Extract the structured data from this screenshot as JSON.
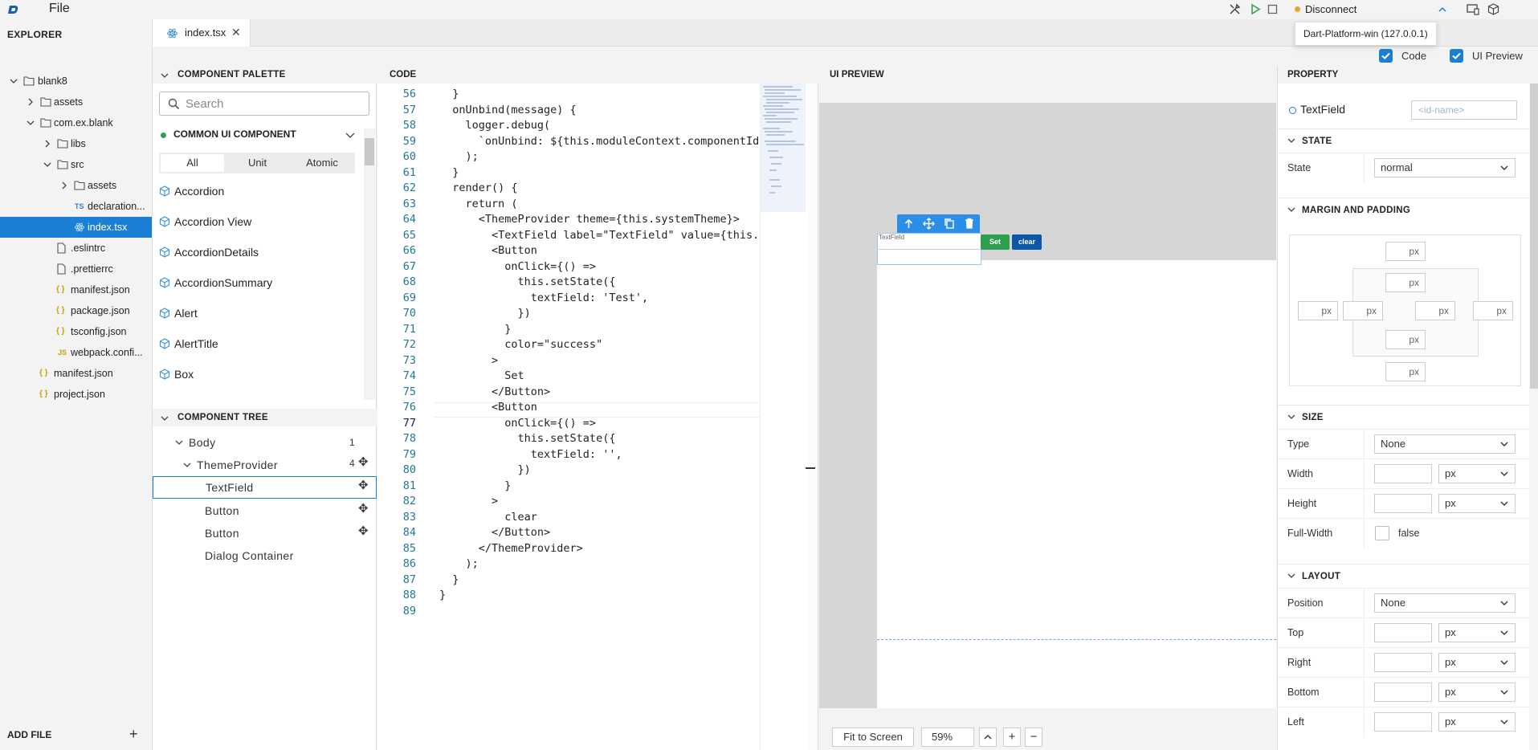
{
  "topbar": {
    "menu_file": "File",
    "connection_label": "Disconnect",
    "connection_status_color": "#f0a030",
    "tooltip": "Dart-Platform-win (127.0.0.1)",
    "icons": [
      "app-logo-icon",
      "tools-icon",
      "play-icon",
      "stop-icon",
      "chevron-up-icon",
      "screen-icon",
      "package-icon"
    ]
  },
  "explorer": {
    "title": "EXPLORER",
    "items": [
      {
        "label": "blank8",
        "type": "folder",
        "expanded": true
      },
      {
        "label": "assets",
        "type": "folder",
        "expanded": false
      },
      {
        "label": "com.ex.blank",
        "type": "folder",
        "expanded": true
      },
      {
        "label": "libs",
        "type": "folder",
        "expanded": false
      },
      {
        "label": "src",
        "type": "folder",
        "expanded": true
      },
      {
        "label": "assets",
        "type": "folder",
        "expanded": false
      },
      {
        "label": "declaration...",
        "type": "ts",
        "badge": "TS"
      },
      {
        "label": "index.tsx",
        "type": "tsx",
        "active": true
      },
      {
        "label": ".eslintrc",
        "type": "file"
      },
      {
        "label": ".prettierrc",
        "type": "file"
      },
      {
        "label": "manifest.json",
        "type": "json",
        "badge": "{ }"
      },
      {
        "label": "package.json",
        "type": "json",
        "badge": "{ }"
      },
      {
        "label": "tsconfig.json",
        "type": "json",
        "badge": "{ }"
      },
      {
        "label": "webpack.confi...",
        "type": "js",
        "badge": "JS"
      },
      {
        "label": "manifest.json",
        "type": "json",
        "badge": "{ }"
      },
      {
        "label": "project.json",
        "type": "json",
        "badge": "{ }"
      }
    ],
    "add_file": "ADD FILE",
    "add_file_symbol": "+"
  },
  "tabs": [
    {
      "label": "index.tsx",
      "close": "✕"
    }
  ],
  "palette": {
    "title": "COMPONENT PALETTE",
    "search_placeholder": "Search",
    "group_title": "COMMON UI COMPONENT",
    "filters": [
      "All",
      "Unit",
      "Atomic"
    ],
    "selected_filter": "All",
    "items": [
      "Accordion",
      "Accordion View",
      "AccordionDetails",
      "AccordionSummary",
      "Alert",
      "AlertTitle",
      "Box"
    ]
  },
  "component_tree": {
    "title": "COMPONENT TREE",
    "nodes": [
      {
        "label": "Body",
        "count": "1"
      },
      {
        "label": "ThemeProvider",
        "count": "4"
      },
      {
        "label": "TextField",
        "selected": true
      },
      {
        "label": "Button"
      },
      {
        "label": "Button"
      },
      {
        "label": "Dialog Container"
      }
    ],
    "move_symbol": "✥"
  },
  "code": {
    "title": "CODE",
    "current_line": "77",
    "lines": [
      {
        "n": "56",
        "t": "  }"
      },
      {
        "n": "57",
        "t": "  onUnbind(message) {"
      },
      {
        "n": "58",
        "t": "    logger.debug("
      },
      {
        "n": "59",
        "t": "      `onUnbind: ${this.moduleContext.componentId}, ${JSON.st"
      },
      {
        "n": "60",
        "t": "    );"
      },
      {
        "n": "61",
        "t": "  }"
      },
      {
        "n": "62",
        "t": "  render() {"
      },
      {
        "n": "63",
        "t": "    return ("
      },
      {
        "n": "64",
        "t": "      <ThemeProvider theme={this.systemTheme}>"
      },
      {
        "n": "65",
        "t": "        <TextField label=\"TextField\" value={this.state.textField}></"
      },
      {
        "n": "66",
        "t": "        <Button"
      },
      {
        "n": "67",
        "t": "          onClick={() =>"
      },
      {
        "n": "68",
        "t": "            this.setState({"
      },
      {
        "n": "69",
        "t": "              textField: 'Test',"
      },
      {
        "n": "70",
        "t": "            })"
      },
      {
        "n": "71",
        "t": "          }"
      },
      {
        "n": "72",
        "t": "          color=\"success\""
      },
      {
        "n": "73",
        "t": "        >"
      },
      {
        "n": "74",
        "t": "          Set"
      },
      {
        "n": "75",
        "t": "        </Button>"
      },
      {
        "n": "76",
        "t": "        <Button"
      },
      {
        "n": "77",
        "t": "          onClick={() =>"
      },
      {
        "n": "78",
        "t": "            this.setState({"
      },
      {
        "n": "79",
        "t": "              textField: '',"
      },
      {
        "n": "80",
        "t": "            })"
      },
      {
        "n": "81",
        "t": "          }"
      },
      {
        "n": "82",
        "t": "        >"
      },
      {
        "n": "83",
        "t": "          clear"
      },
      {
        "n": "84",
        "t": "        </Button>"
      },
      {
        "n": "85",
        "t": "      </ThemeProvider>"
      },
      {
        "n": "86",
        "t": "    );"
      },
      {
        "n": "87",
        "t": "  }"
      },
      {
        "n": "88",
        "t": "}"
      },
      {
        "n": "89",
        "t": ""
      }
    ]
  },
  "preview": {
    "title": "UI PREVIEW",
    "textfield_label": "TextField",
    "set_button": "Set",
    "clear_button": "clear",
    "set_color": "#2e9e4f",
    "clear_color": "#0b57a8",
    "fit_to_screen": "Fit to Screen",
    "zoom": "59%",
    "zoom_in": "+",
    "zoom_out": "−"
  },
  "view_toggles": {
    "code_label": "Code",
    "code_checked": true,
    "preview_label": "UI Preview",
    "preview_checked": true
  },
  "property": {
    "title": "PROPERTY",
    "component_name": "TextField",
    "id_placeholder": "<id-name>",
    "sections": {
      "state": "STATE",
      "margin_padding": "MARGIN AND PADDING",
      "size": "SIZE",
      "layout": "LAYOUT"
    },
    "state_label": "State",
    "state_value": "normal",
    "unit": "px",
    "size_type_label": "Type",
    "size_type_value": "None",
    "width_label": "Width",
    "height_label": "Height",
    "full_width_label": "Full-Width",
    "full_width_value": "false",
    "position_label": "Position",
    "position_value": "None",
    "top_label": "Top",
    "right_label": "Right",
    "bottom_label": "Bottom",
    "left_label": "Left"
  },
  "accent_color": "#1b7fd6"
}
